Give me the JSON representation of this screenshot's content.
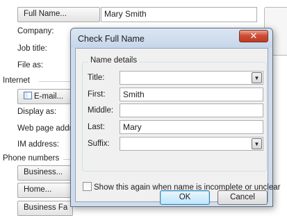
{
  "form": {
    "full_name_button": "Full Name...",
    "full_name_value": "Mary Smith",
    "company_label": "Company:",
    "job_title_label": "Job title:",
    "file_as_label": "File as:",
    "internet_section": "Internet",
    "email_button": "E-mail...",
    "display_as_label": "Display as:",
    "web_page_label": "Web page addr",
    "im_address_label": "IM address:",
    "phone_section": "Phone numbers",
    "business_button": "Business...",
    "home_button": "Home...",
    "business_fax_button": "Business Fa"
  },
  "dialog": {
    "title": "Check Full Name",
    "close_glyph": "✕",
    "group_label": "Name details",
    "fields": {
      "title_label": "Title:",
      "title_value": "",
      "first_label": "First:",
      "first_value": "Smith",
      "middle_label": "Middle:",
      "middle_value": "",
      "last_label": "Last:",
      "last_value": "Mary",
      "suffix_label": "Suffix:",
      "suffix_value": ""
    },
    "checkbox_label": "Show this again when name is incomplete or unclear",
    "checkbox_checked": false,
    "ok_label": "OK",
    "cancel_label": "Cancel"
  },
  "colors": {
    "accent": "#3c7fb1",
    "close_button": "#c03a22",
    "dialog_frame": "#cfdcec"
  }
}
